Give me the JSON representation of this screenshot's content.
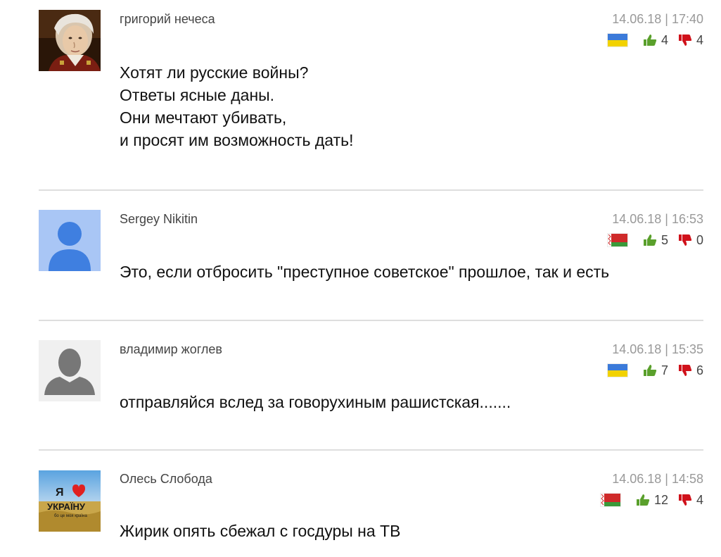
{
  "comments": [
    {
      "author": "григорий нечеса",
      "date": "14.06.18 | 17:40",
      "flag": "ukraine-flag",
      "likes": "4",
      "dislikes": "4",
      "lines": [
        "Хотят ли русские войны?",
        "Ответы ясные даны.",
        "Они мечтают убивать,",
        "и просят им возможность дать!"
      ],
      "avatar": "portrait-avatar"
    },
    {
      "author": "Sergey Nikitin",
      "date": "14.06.18 | 16:53",
      "flag": "belarus-flag",
      "likes": "5",
      "dislikes": "0",
      "lines": [
        "Это, если отбросить \"преступное советское\" прошлое, так и есть"
      ],
      "avatar": "default-blue-avatar"
    },
    {
      "author": "владимир жоглев",
      "date": "14.06.18 | 15:35",
      "flag": "ukraine-flag",
      "likes": "7",
      "dislikes": "6",
      "lines": [
        "отправляйся вслед за говорухиным рашистская......."
      ],
      "avatar": "default-gray-avatar"
    },
    {
      "author": "Олесь Слобода",
      "date": "14.06.18 | 14:58",
      "flag": "belarus-flag",
      "likes": "12",
      "dislikes": "4",
      "lines": [
        "Жирик опять сбежал с госдуры на ТВ"
      ],
      "avatar": "ukraine-love-avatar",
      "avatar_text": {
        "line1": "Я",
        "line2": "УКРАЇНУ",
        "line3": "бо це моя країна"
      }
    }
  ],
  "colors": {
    "thumb_up": "#5aa02c",
    "thumb_down": "#d0121b",
    "divider": "#dedede",
    "date": "#999999"
  }
}
